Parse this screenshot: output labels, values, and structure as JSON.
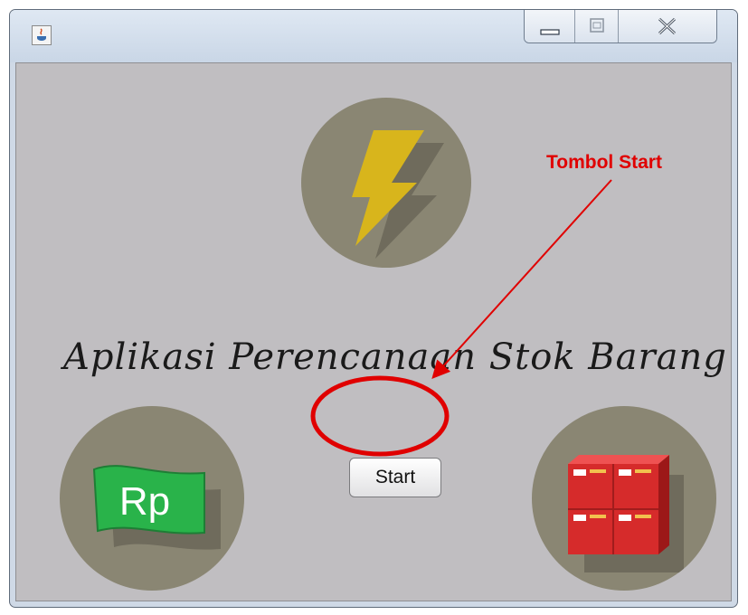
{
  "window": {
    "icon": "java-icon",
    "controls": [
      "minimize-icon",
      "maximize-icon",
      "close-icon"
    ]
  },
  "app": {
    "title": "Aplikasi Perencanaan Stok Barang",
    "start_label": "Start"
  },
  "icons": {
    "top": "lightning-icon",
    "bottom_left": {
      "name": "money-rp-icon",
      "text": "Rp"
    },
    "bottom_right": {
      "name": "boxes-icon"
    }
  },
  "annotation": {
    "label": "Tombol Start",
    "color": "#e00000"
  },
  "colors": {
    "background": "#c0bec1",
    "circle": "#8a8673",
    "lightning": "#d8b51c",
    "money": "#29b34a",
    "boxes": "#d62b2b"
  }
}
